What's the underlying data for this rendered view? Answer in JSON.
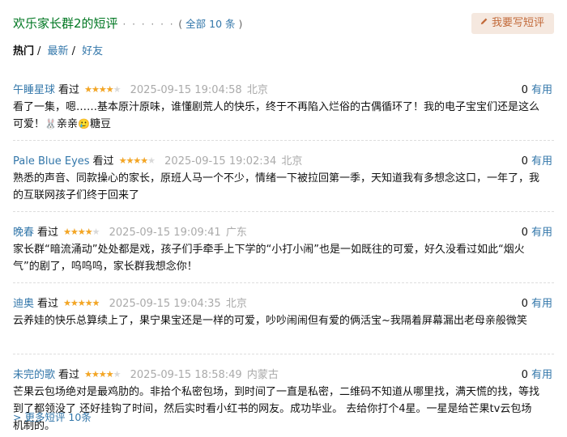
{
  "header": {
    "title": "欢乐家长群2的短评",
    "dots": "· · · · · ·",
    "count_prefix": "( ",
    "count_link": "全部 10 条",
    "count_suffix": " )",
    "write_label": "我要写短评",
    "write_icon": "pencil-icon"
  },
  "tabs": [
    {
      "label": "热门"
    },
    {
      "label": "最新"
    },
    {
      "label": "好友"
    }
  ],
  "comments": [
    {
      "user": "午睡星球",
      "status": "看过",
      "rating": 4,
      "time": "2025-09-15 19:04:58",
      "location": "北京",
      "useful_count": "0",
      "useful_label": "有用",
      "text": "看了一集，嗯……基本原汁原味，谁懂剧荒人的快乐，终于不再陷入烂俗的古偶循环了！我的电子宝宝们还是这么可爱！",
      "emoji1": "🐰",
      "tag1": "亲亲",
      "emoji2": "🥲",
      "tag2": "糖豆"
    },
    {
      "user": "Pale Blue Eyes",
      "status": "看过",
      "rating": 4,
      "time": "2025-09-15 19:02:34",
      "location": "北京",
      "useful_count": "0",
      "useful_label": "有用",
      "text": "熟悉的声音、同款操心的家长，原班人马一个不少，情绪一下被拉回第一季，天知道我有多想念这口，一年了，我的互联网孩子们终于回来了"
    },
    {
      "user": "晚春",
      "status": "看过",
      "rating": 4,
      "time": "2025-09-15 19:09:41",
      "location": "广东",
      "useful_count": "0",
      "useful_label": "有用",
      "text": "家长群“暗流涌动”处处都是戏，孩子们手牵手上下学的“小打小闹”也是一如既往的可爱，好久没看过如此“烟火气”的剧了，呜呜呜，家长群我想念你！"
    },
    {
      "user": "迪奥",
      "status": "看过",
      "rating": 5,
      "time": "2025-09-15 19:04:35",
      "location": "北京",
      "useful_count": "0",
      "useful_label": "有用",
      "text": "云养娃的快乐总算续上了，果宁果宝还是一样的可爱，吵吵闹闹但有爱的俩活宝~我隔着屏幕漏出老母亲般微笑"
    },
    {
      "user": "未完的歌",
      "status": "看过",
      "rating": 4,
      "time": "2025-09-15 18:58:49",
      "location": "内蒙古",
      "useful_count": "0",
      "useful_label": "有用",
      "text": "芒果云包场绝对是最鸡肋的。非拾个私密包场，到时间了一直是私密，二维码不知道从哪里找，满天慌的找，等找到了都领没了 还好挂钩了时间，然后实时看小红书的网友。成功毕业。 去给你打个4星。一星是给芒果tv云包场机制的。"
    }
  ],
  "more_link": "> 更多短评 10条",
  "colors": {
    "title_green": "#007722",
    "link_blue": "#3377aa",
    "star_orange": "#f5a623",
    "write_bg": "#f5e8df",
    "write_text": "#c26a3a"
  }
}
